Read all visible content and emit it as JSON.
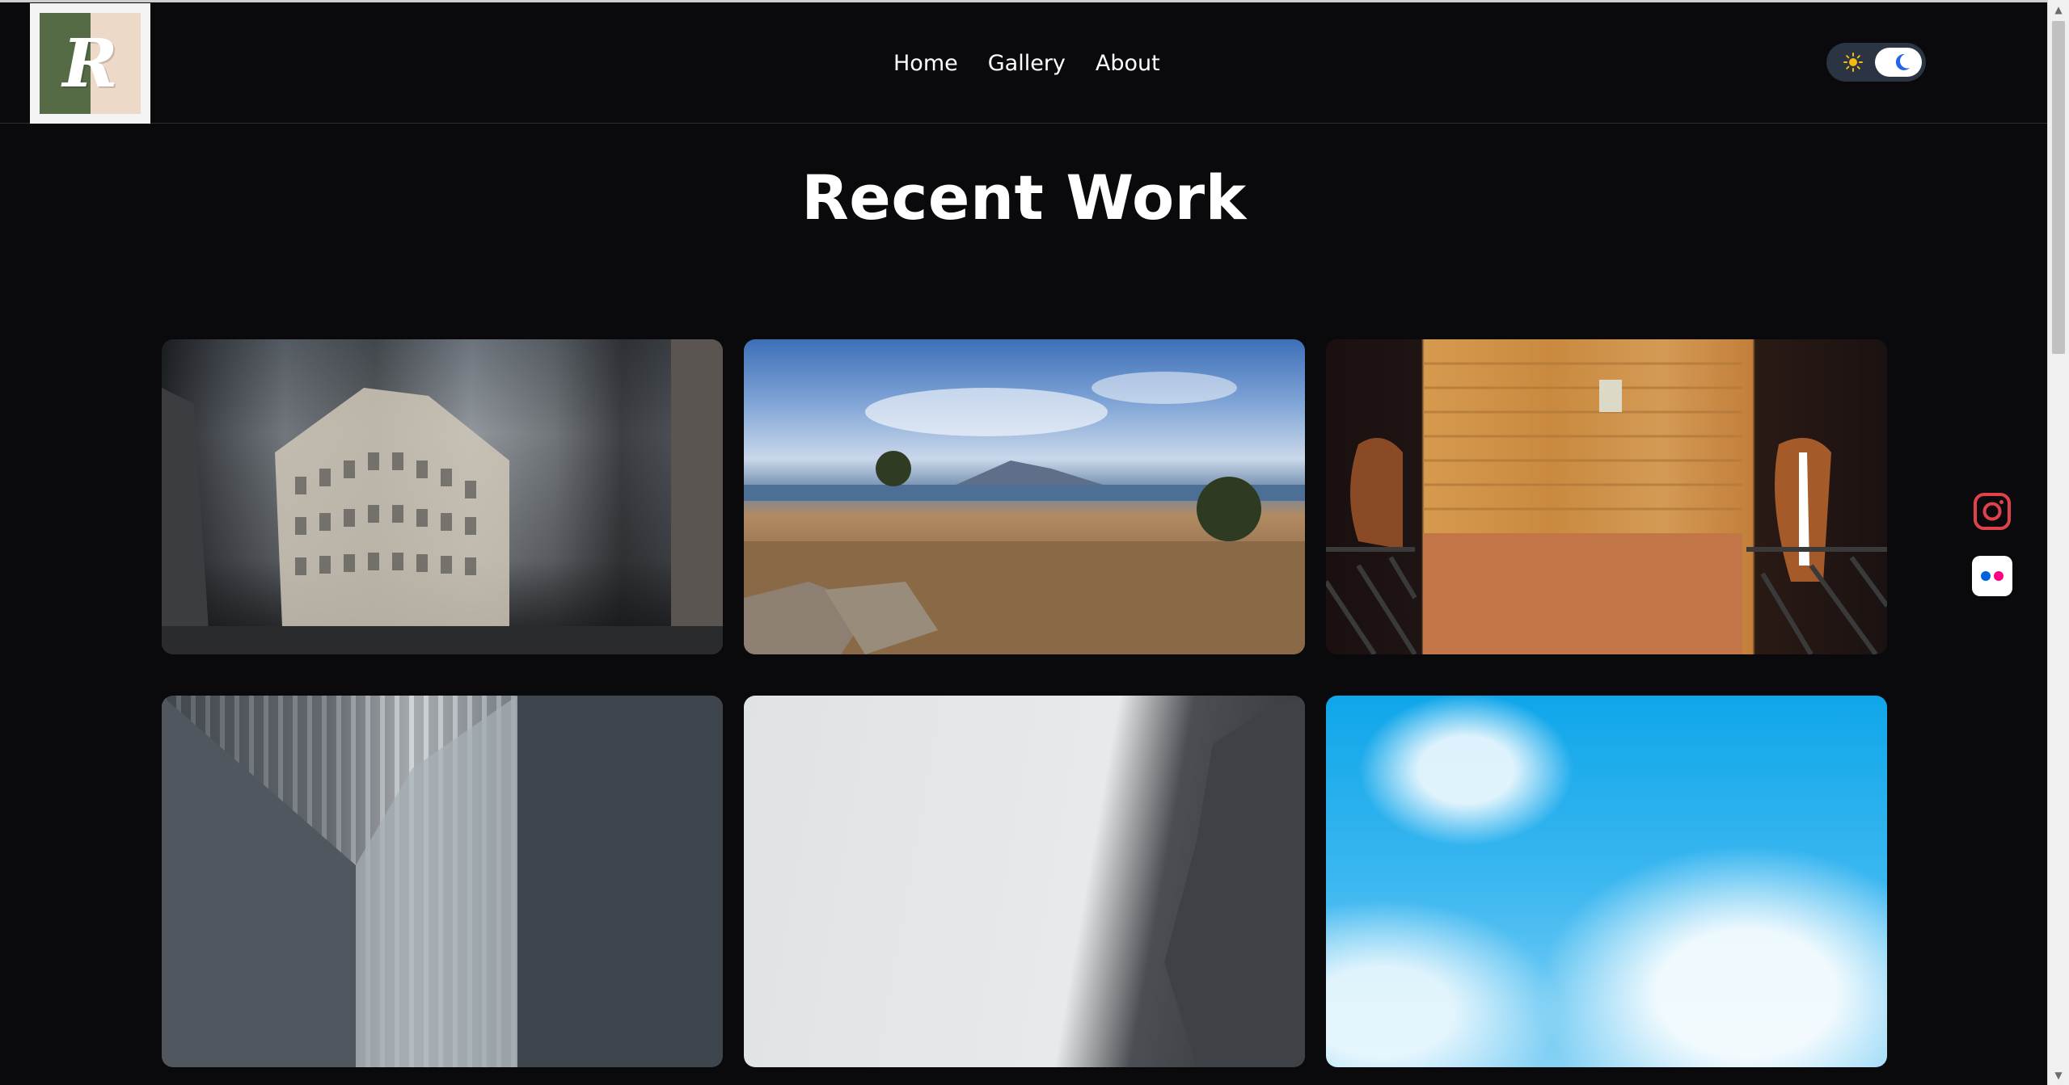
{
  "nav": {
    "items": [
      "Home",
      "Gallery",
      "About"
    ]
  },
  "theme_toggle": {
    "state": "dark",
    "sun_icon": "sun-icon",
    "moon_icon": "moon-icon"
  },
  "hero": {
    "title": "Recent Work"
  },
  "gallery": {
    "images": [
      {
        "subject": "paris-building"
      },
      {
        "subject": "mountain-landscape"
      },
      {
        "subject": "horses-stable"
      },
      {
        "subject": "skyscrapers"
      },
      {
        "subject": "rock-cliff"
      },
      {
        "subject": "blue-sky-clouds"
      }
    ]
  },
  "social": {
    "icons": [
      "instagram-icon",
      "flickr-icon"
    ]
  },
  "colors": {
    "background": "#0a0a0d",
    "logo_green": "#556b45",
    "logo_tan": "#ecd9c7",
    "toggle_bg": "#2b3442",
    "instagram_red": "#e1306c",
    "flickr_blue": "#0063dc",
    "flickr_pink": "#ff0084"
  },
  "logo": {
    "letter": "R"
  }
}
